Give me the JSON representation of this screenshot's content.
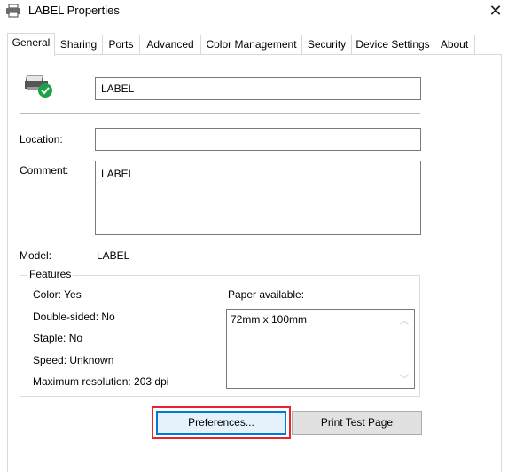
{
  "window": {
    "title": "LABEL Properties",
    "close_glyph": "✕"
  },
  "tabs": [
    {
      "label": "General",
      "active": true
    },
    {
      "label": "Sharing"
    },
    {
      "label": "Ports"
    },
    {
      "label": "Advanced"
    },
    {
      "label": "Color Management"
    },
    {
      "label": "Security"
    },
    {
      "label": "Device Settings"
    },
    {
      "label": "About"
    }
  ],
  "general": {
    "printer_name": "LABEL",
    "location_label": "Location:",
    "location_value": "",
    "comment_label": "Comment:",
    "comment_value": "LABEL",
    "model_label": "Model:",
    "model_value": "LABEL"
  },
  "features": {
    "title": "Features",
    "color": "Color: Yes",
    "double_sided": "Double-sided: No",
    "staple": "Staple: No",
    "speed": "Speed: Unknown",
    "max_resolution": "Maximum resolution: 203 dpi",
    "paper_label": "Paper available:",
    "paper_options": [
      "72mm x 100mm"
    ]
  },
  "buttons": {
    "preferences": "Preferences...",
    "print_test_page": "Print Test Page"
  },
  "colors": {
    "highlight": "#e8232a",
    "focus": "#0078d7",
    "status_ok": "#1aa24a"
  }
}
